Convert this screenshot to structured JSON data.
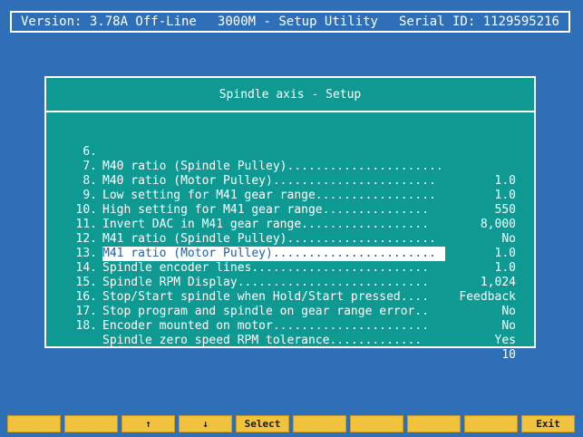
{
  "header": {
    "version": "Version: 3.78A Off-Line",
    "title": "3000M - Setup Utility",
    "serial": "Serial ID: 1129595216"
  },
  "dialog": {
    "title": "Spindle axis - Setup",
    "rows": [
      {
        "num": "6.",
        "label": "M40 ratio (Spindle Pulley)......................",
        "value": "1.0"
      },
      {
        "num": "7.",
        "label": "M40 ratio (Motor Pulley).......................",
        "value": "1.0"
      },
      {
        "num": "8.",
        "label": "Low setting for M41 gear range.................",
        "value": "550"
      },
      {
        "num": "9.",
        "label": "High setting for M41 gear range...............",
        "value": "8,000"
      },
      {
        "num": "10.",
        "label": "Invert DAC in M41 gear range..................",
        "value": "No"
      },
      {
        "num": "11.",
        "label": "M41 ratio (Spindle Pulley).....................",
        "value": "1.0"
      },
      {
        "num": "12.",
        "label": "M41 ratio (Motor Pulley).......................",
        "value": "1.0"
      },
      {
        "num": "13.",
        "label": "Spindle encoder lines.........................",
        "value": "1,024"
      },
      {
        "num": "14.",
        "label": "Spindle RPM Display...........................",
        "value": "Feedback"
      },
      {
        "num": "15.",
        "label": "Stop/Start spindle when Hold/Start pressed....",
        "value": "No"
      },
      {
        "num": "16.",
        "label": "Stop program and spindle on gear range error..",
        "value": "No"
      },
      {
        "num": "17.",
        "label": "Encoder mounted on motor......................",
        "value": "Yes"
      },
      {
        "num": "18.",
        "label": "Spindle zero speed RPM tolerance.............",
        "value": "10"
      }
    ],
    "selected_index": 6
  },
  "fkeys": [
    "",
    "",
    "↑",
    "↓",
    "Select",
    "",
    "",
    "",
    "",
    "Exit"
  ],
  "colors": {
    "background": "#2f6fb8",
    "dialog": "#0e9a93",
    "fkey": "#f0c23d",
    "highlight_text": "#1f5fb0"
  }
}
